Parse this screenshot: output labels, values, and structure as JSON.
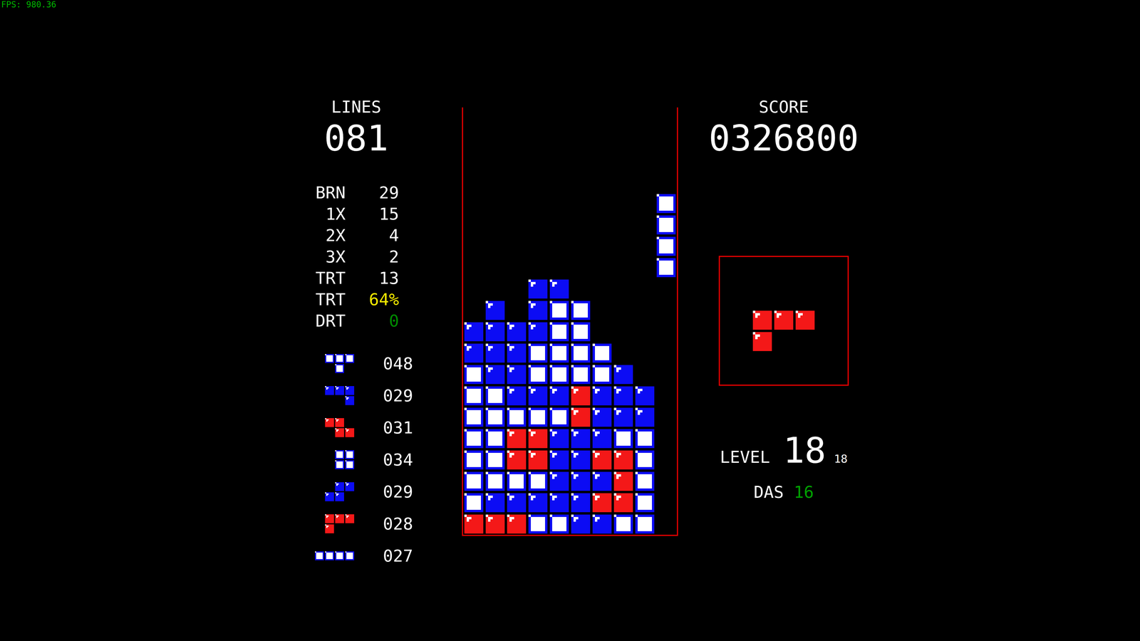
{
  "fps": "FPS: 980.36",
  "lines": {
    "label": "LINES",
    "value": "081"
  },
  "stats": [
    {
      "label": "BRN",
      "value": "29",
      "color": "#ffffff"
    },
    {
      "label": "1X",
      "value": "15",
      "color": "#ffffff"
    },
    {
      "label": "2X",
      "value": "4",
      "color": "#ffffff"
    },
    {
      "label": "3X",
      "value": "2",
      "color": "#ffffff"
    },
    {
      "label": "TRT",
      "value": "13",
      "color": "#ffffff"
    },
    {
      "label": "TRT",
      "value": "64%",
      "color": "#f4e800"
    },
    {
      "label": "DRT",
      "value": "0",
      "color": "#008a00"
    }
  ],
  "piece_stats": [
    {
      "kind": "T",
      "count": "048",
      "color": "W"
    },
    {
      "kind": "J",
      "count": "029",
      "color": "B"
    },
    {
      "kind": "Z",
      "count": "031",
      "color": "R"
    },
    {
      "kind": "O",
      "count": "034",
      "color": "W"
    },
    {
      "kind": "S",
      "count": "029",
      "color": "B"
    },
    {
      "kind": "L",
      "count": "028",
      "color": "R"
    },
    {
      "kind": "I",
      "count": "027",
      "color": "W"
    }
  ],
  "board": {
    "rows": [
      "..........",
      "..........",
      "..........",
      "..........",
      ".........W",
      ".........W",
      ".........W",
      ".........W",
      "...BB.....",
      ".B.BWW....",
      "BBBBWW....",
      "BBBWWWW...",
      "WBBWWWWB..",
      "WWBBBRBBB.",
      "WWWWWRBBB.",
      "WWRRBBBWW.",
      "WWRRBBRRW.",
      "WWWWBBBRW.",
      "WBBBBBRRW.",
      "RRRWWBBWW."
    ]
  },
  "score": {
    "label": "SCORE",
    "value": "0326800"
  },
  "next": {
    "kind": "L",
    "color": "R"
  },
  "level": {
    "label": "LEVEL",
    "value": "18",
    "start": "18"
  },
  "das": {
    "label": "DAS",
    "value": "16",
    "color": "#00a000"
  }
}
